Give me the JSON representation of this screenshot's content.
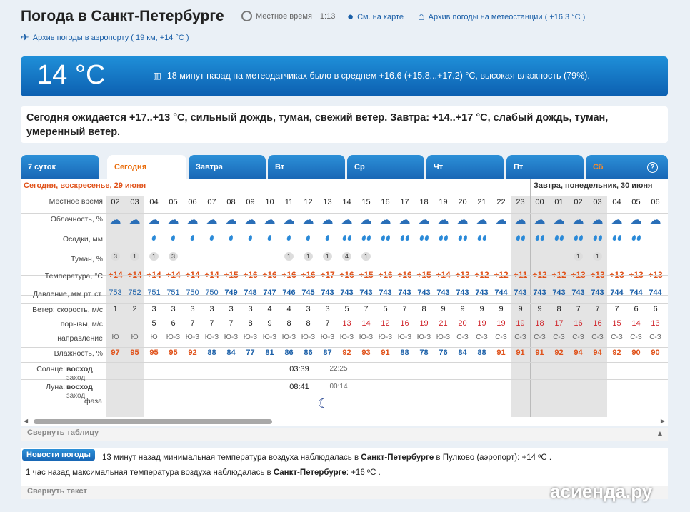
{
  "header": {
    "title": "Погода в Санкт-Петербурге",
    "local_time_label": "Местное время",
    "local_time": "1:13",
    "map_link": "См. на карте",
    "station_archive": "Архив погоды на метеостанции ( +16.3 °C )",
    "airport_archive": "Архив погоды в аэропорту ( 19 км, +14 °C )"
  },
  "current": {
    "temp": "14 °C",
    "sensor_text": "18 минут назад на метеодатчиках было в среднем +16.6 (+15.8...+17.2) °C, высокая влажность (79%)."
  },
  "forecast_text": "Сегодня ожидается +17..+13 °C, сильный дождь, туман, свежий ветер. Завтра: +14..+17 °C, слабый дождь, туман, умеренный ветер.",
  "tabs": [
    "7 суток",
    "Сегодня",
    "Завтра",
    "Вт",
    "Ср",
    "Чт",
    "Пт",
    "Сб"
  ],
  "help": "?",
  "days": {
    "today": "Сегодня, воскресенье, 29 июня",
    "tomorrow": "Завтра, понедельник, 30 июня"
  },
  "labels": {
    "time": "Местное время",
    "cloud": "Облачность, %",
    "precip": "Осадки, мм",
    "fog": "Туман, %",
    "temp": "Температура, °C",
    "pressure": "Давление, мм рт. ст.",
    "wind": "Ветер: скорость, м/с",
    "gusts": "порывы, м/с",
    "dir": "направление",
    "hum": "Влажность, %",
    "sun": "Солнце:",
    "sun_rise": "восход",
    "sun_set": "заход",
    "moon": "Луна:",
    "moon_rise": "восход",
    "moon_set": "заход",
    "phase": "фаза"
  },
  "hours": [
    "02",
    "03",
    "04",
    "05",
    "06",
    "07",
    "08",
    "09",
    "10",
    "11",
    "12",
    "13",
    "14",
    "15",
    "16",
    "17",
    "18",
    "19",
    "20",
    "21",
    "22",
    "23",
    "00",
    "01",
    "02",
    "03",
    "04",
    "05",
    "06"
  ],
  "temps": [
    "+14",
    "+14",
    "+14",
    "+14",
    "+14",
    "+14",
    "+15",
    "+16",
    "+16",
    "+16",
    "+16",
    "+17",
    "+16",
    "+15",
    "+16",
    "+16",
    "+15",
    "+14",
    "+13",
    "+12",
    "+12",
    "+11",
    "+12",
    "+12",
    "+13",
    "+13",
    "+13",
    "+13",
    "+13"
  ],
  "pressure": [
    "753",
    "752",
    "751",
    "751",
    "750",
    "750",
    "749",
    "748",
    "747",
    "746",
    "745",
    "743",
    "743",
    "743",
    "743",
    "743",
    "743",
    "743",
    "743",
    "743",
    "744",
    "743",
    "743",
    "743",
    "743",
    "743",
    "744",
    "744",
    "744"
  ],
  "wind": [
    "1",
    "2",
    "3",
    "3",
    "3",
    "3",
    "3",
    "3",
    "4",
    "4",
    "3",
    "3",
    "5",
    "7",
    "5",
    "7",
    "8",
    "9",
    "9",
    "9",
    "9",
    "9",
    "9",
    "8",
    "7",
    "7",
    "7",
    "6",
    "6"
  ],
  "gusts": [
    "",
    "",
    "5",
    "6",
    "7",
    "7",
    "7",
    "8",
    "9",
    "8",
    "8",
    "7",
    "13",
    "14",
    "12",
    "16",
    "19",
    "21",
    "20",
    "19",
    "19",
    "19",
    "18",
    "17",
    "16",
    "16",
    "15",
    "14",
    "13"
  ],
  "dirs": [
    "Ю",
    "Ю",
    "Ю",
    "Ю-З",
    "Ю-З",
    "Ю-З",
    "Ю-З",
    "Ю-З",
    "Ю-З",
    "Ю-З",
    "Ю-З",
    "Ю-З",
    "Ю-З",
    "Ю-З",
    "Ю-З",
    "Ю-З",
    "Ю-З",
    "Ю-З",
    "С-З",
    "С-З",
    "С-З",
    "С-З",
    "С-З",
    "С-З",
    "С-З",
    "С-З",
    "С-З",
    "С-З",
    "С-З"
  ],
  "hum": [
    "97",
    "95",
    "95",
    "95",
    "92",
    "88",
    "84",
    "77",
    "81",
    "86",
    "86",
    "87",
    "92",
    "93",
    "91",
    "88",
    "78",
    "76",
    "84",
    "88",
    "91",
    "91",
    "91",
    "92",
    "94",
    "94",
    "92",
    "90",
    "90"
  ],
  "fog": {
    "0": "3",
    "1": "1",
    "2": "1",
    "3": "3",
    "9": "1",
    "10": "1",
    "11": "1",
    "12": "4",
    "13": "1",
    "24": "1",
    "25": "1"
  },
  "sun": {
    "rise": "03:39",
    "set": "22:25"
  },
  "moon": {
    "rise": "08:41",
    "set": "00:14"
  },
  "collapse_table": "Свернуть таблицу",
  "news": {
    "label": "Новости погоды",
    "line1_pre": "13 минут назад минимальная температура воздуха наблюдалась в ",
    "line1_city": "Санкт-Петербурге",
    "line1_post": " в Пулково (аэропорт): +14 ºC .",
    "line2_pre": "1 час назад максимальная температура воздуха наблюдалась в ",
    "line2_city": "Санкт-Петербурге",
    "line2_post": ": +16 ºC ."
  },
  "collapse_text": "Свернуть текст",
  "logo": "асиенда.ру",
  "colors": {
    "accent": "#1a5fa8",
    "temp": "#e0521a",
    "tab": "#1f78c8"
  }
}
